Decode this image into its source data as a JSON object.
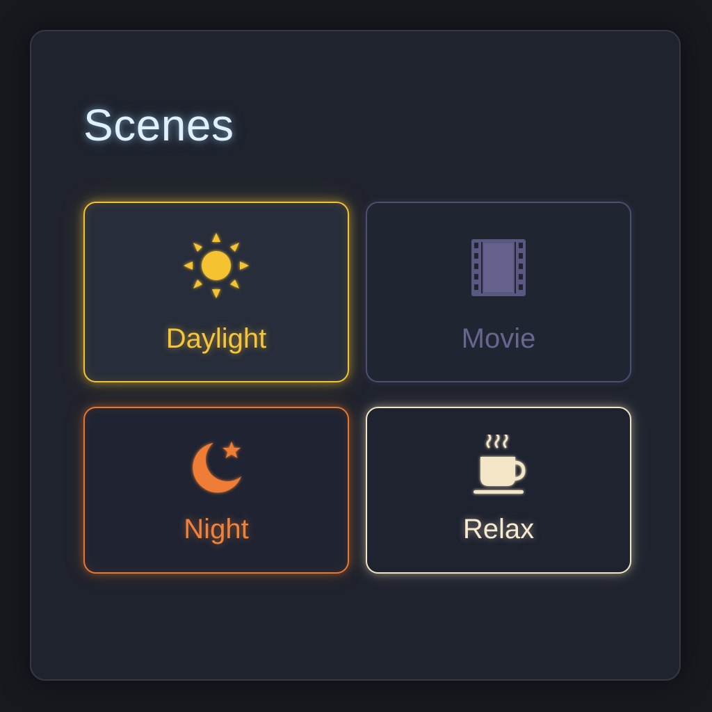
{
  "panel": {
    "title": "Scenes"
  },
  "scenes": [
    {
      "label": "Daylight",
      "icon": "sun-icon",
      "color": "#f5c232",
      "active": true
    },
    {
      "label": "Movie",
      "icon": "film-icon",
      "color": "#5a5880",
      "active": false
    },
    {
      "label": "Night",
      "icon": "moon-star-icon",
      "color": "#e9772f",
      "active": true
    },
    {
      "label": "Relax",
      "icon": "coffee-cup-icon",
      "color": "#f3e6c6",
      "active": true
    }
  ]
}
